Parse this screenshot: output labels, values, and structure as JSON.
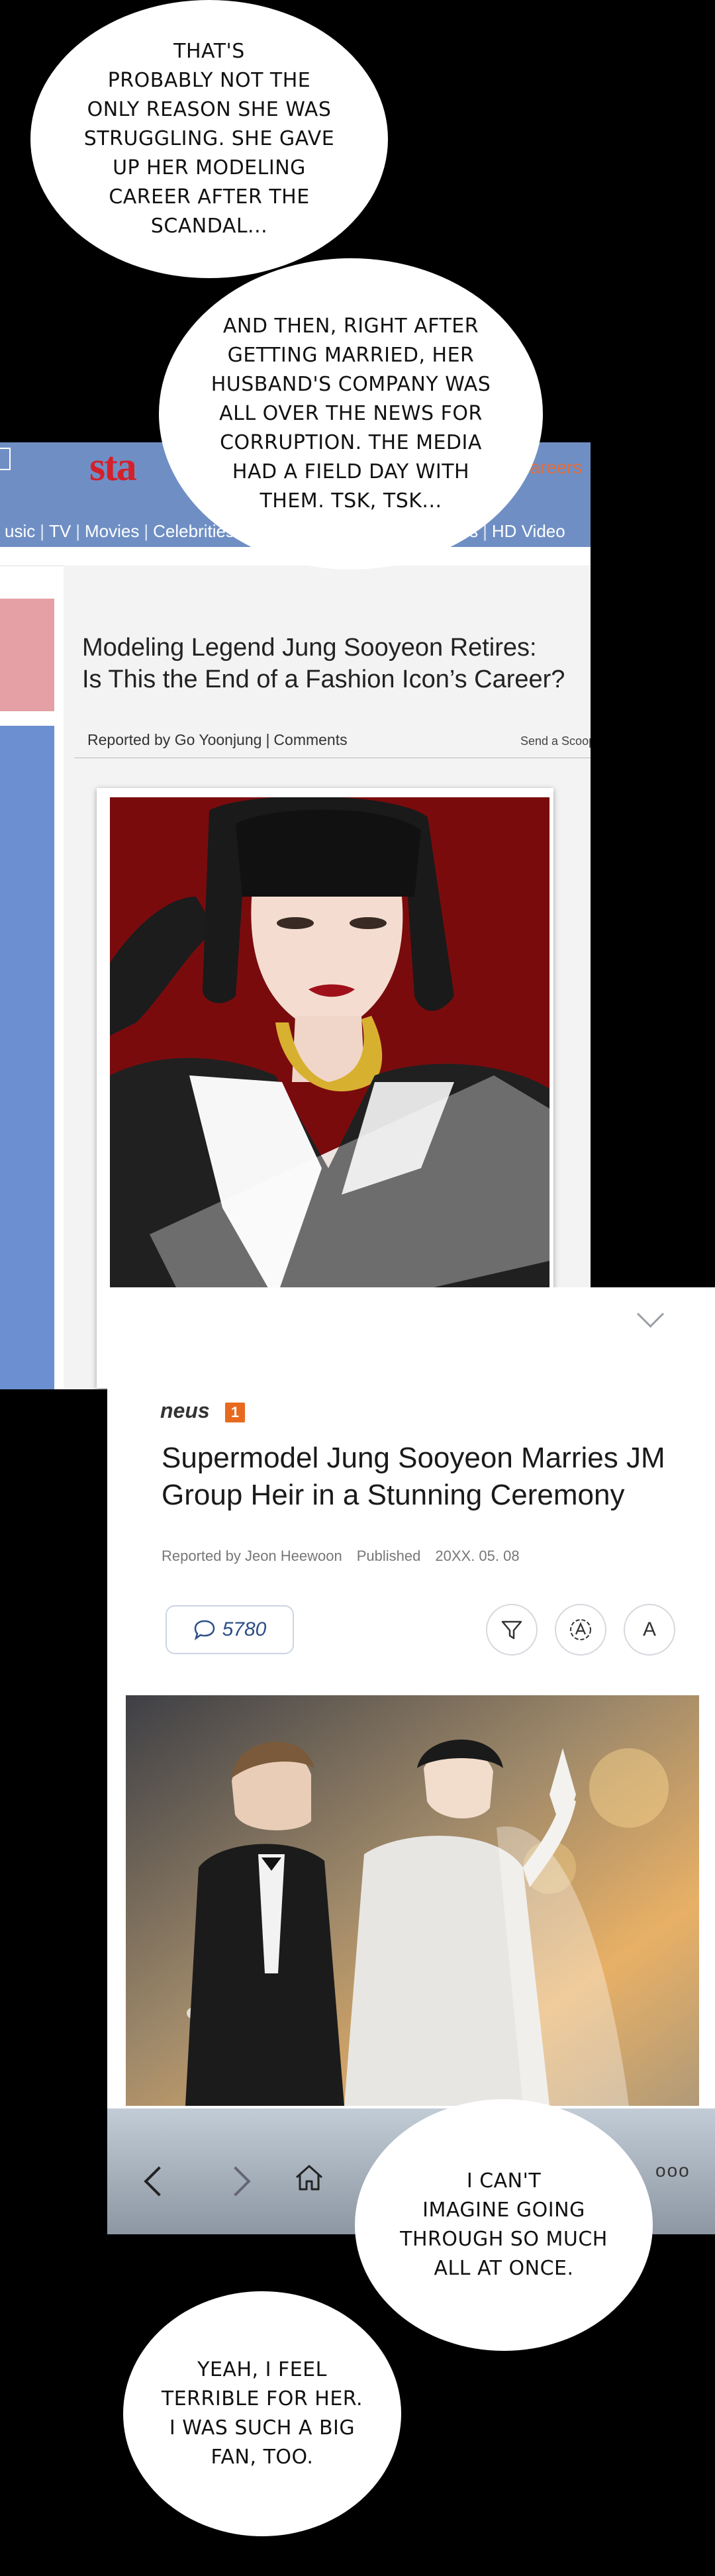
{
  "bubbles": {
    "b1": "THAT'S\nPROBABLY NOT THE\nONLY REASON SHE WAS\nSTRUGGLING. SHE GAVE\nUP HER MODELING\nCAREER AFTER THE\nSCANDAL...",
    "b2": "AND THEN, RIGHT AFTER\nGETTING MARRIED, HER\nHUSBAND'S COMPANY WAS\nALL OVER THE NEWS FOR\nCORRUPTION. THE MEDIA\nHAD A FIELD DAY WITH\nTHEM. TSK, TSK...",
    "b3": "I CAN'T\nIMAGINE GOING\nTHROUGH SO MUCH\nALL AT ONCE.",
    "b4": "YEAH, I FEEL\nTERRIBLE FOR HER.\nI WAS SUCH A BIG\nFAN, TOO."
  },
  "article1": {
    "logo": "sta",
    "careers": "areers",
    "nav": [
      "usic",
      "TV",
      "Movies",
      "Celebrities"
    ],
    "nav_right": [
      "ams",
      "HD Video"
    ],
    "headline_line1": "Modeling Legend Jung Sooyeon Retires:",
    "headline_line2": "Is This the End of a Fashion Icon’s Career?",
    "reporter": "Reported by Go Yoonjung",
    "comments": "Comments",
    "send_scoop": "Send a Scoop"
  },
  "article2": {
    "brand": "neus",
    "brand_badge": "1",
    "headline_line1": "Supermodel Jung Sooyeon Marries JM",
    "headline_line2": "Group Heir in a Stunning Ceremony",
    "reporter": "Reported by Jeon Heewoon",
    "published_label": "Published",
    "published_date": "20XX. 05. 08",
    "comment_count": "5780",
    "font_button": "A",
    "more": "ooo"
  },
  "colors": {
    "accent_blue": "#6f8fc4",
    "logo_red": "#d4202b",
    "photo_red": "#7a0b0d",
    "badge_orange": "#e86a1f"
  }
}
